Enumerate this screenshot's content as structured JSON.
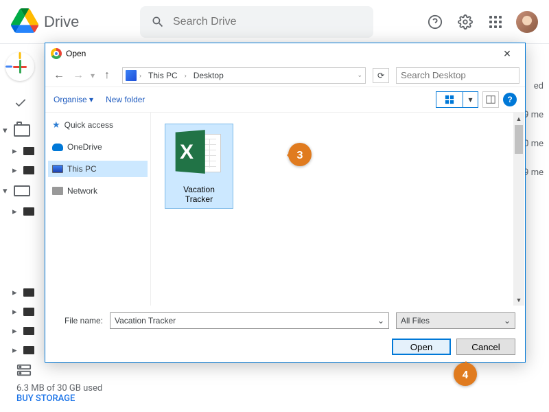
{
  "drive": {
    "logo_text": "Drive",
    "search_placeholder": "Search Drive",
    "storage_used": "6.3 MB of 30 GB used",
    "buy_storage": "BUY STORAGE",
    "row_hints": [
      "ed",
      "9 me",
      "0 me",
      "9 me"
    ]
  },
  "dialog": {
    "title": "Open",
    "breadcrumb": [
      "This PC",
      "Desktop"
    ],
    "search_placeholder": "Search Desktop",
    "toolbar": {
      "organise": "Organise",
      "new_folder": "New folder"
    },
    "tree": {
      "quick_access": "Quick access",
      "onedrive": "OneDrive",
      "this_pc": "This PC",
      "network": "Network"
    },
    "file": {
      "name": "Vacation Tracker"
    },
    "footer": {
      "file_name_label": "File name:",
      "file_name_value": "Vacation Tracker",
      "filter": "All Files",
      "open": "Open",
      "cancel": "Cancel"
    }
  },
  "callouts": {
    "c3": "3",
    "c4": "4"
  }
}
